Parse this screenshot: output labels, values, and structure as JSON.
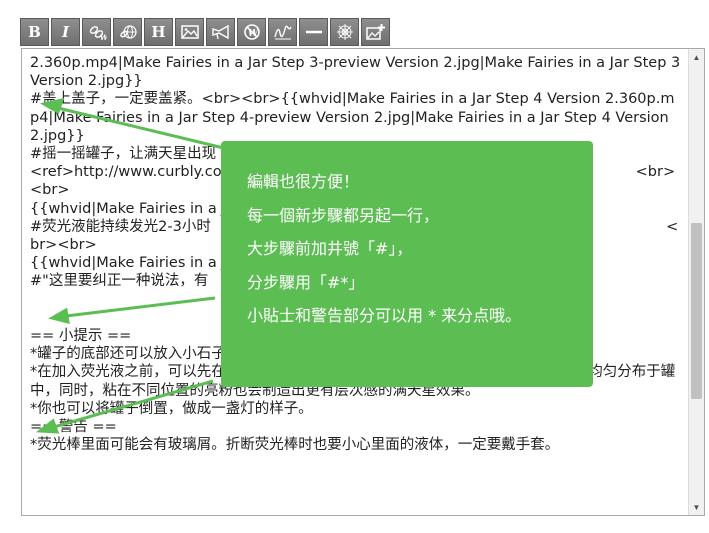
{
  "toolbar": {
    "bold_label": "B",
    "italic_label": "I",
    "heading_label": "H",
    "buttons": [
      "bold",
      "italic",
      "wikilink",
      "external-link",
      "heading",
      "image",
      "horn",
      "nowiki",
      "signature",
      "horizontal-line",
      "spider-web",
      "add-image"
    ]
  },
  "editor": {
    "text": "2.360p.mp4|Make Fairies in a Jar Step 3-preview Version 2.jpg|Make Fairies in a Jar Step 3 Version 2.jpg}}\n#盖上盖子，一定要盖紧。<br><br>{{whvid|Make Fairies in a Jar Step 4 Version 2.360p.mp4|Make Fairies in a Jar Step 4-preview Version 2.jpg|Make Fairies in a Jar Step 4 Version 2.jpg}}\n#摇一摇罐子，让满天星出现\n<ref>http://www.curbly.com                    ck-lanterns?__cf_waf_tk__=05                    <br><br>\n{{whvid|Make Fairies in a Ja                    Step 5-preview Version 2.jpg|Make\n#荧光液能持续发光2-3小时                    的荧光液就可以了。<ref>http://www.in                    <br><br>\n{{whvid|Make Fairies in a Ja                    Step 6-preview Version 2.jpg|Make\n#\"这里要纠正一种说法，有                    光棒的发光时间确实可以延长，但光的\n\n\n== 小提示 ==\n*罐子的底部还可以放入小石子、青苔、叶子甚至是小型的精灵人偶来装饰一下。\n*在加入荧光液之前，可以先在罐子里放一些薄纱，薄纱可以吸收荧光液，从而使得荧光均匀分布于罐中，同时，粘在不同位置的亮粉也会制造出更有层次感的满天星效果。\n*你也可以将罐子倒置，做成一盏灯的样子。\n== 警告 ==\n*荧光棒里面可能会有玻璃屑。折断荧光棒时也要小心里面的液体，一定要戴手套。"
  },
  "callout": {
    "lines": [
      "編輯也很方便！",
      "每一個新步驟都另起一行，",
      "大步驟前加井號「#」，",
      "分步驟用「#*」",
      "小貼士和警告部分可以用 * 来分点哦。"
    ],
    "color": "#5cbd53"
  },
  "colors": {
    "toolbar_button": "#7f7f7f",
    "arrow": "#5cbd53"
  }
}
